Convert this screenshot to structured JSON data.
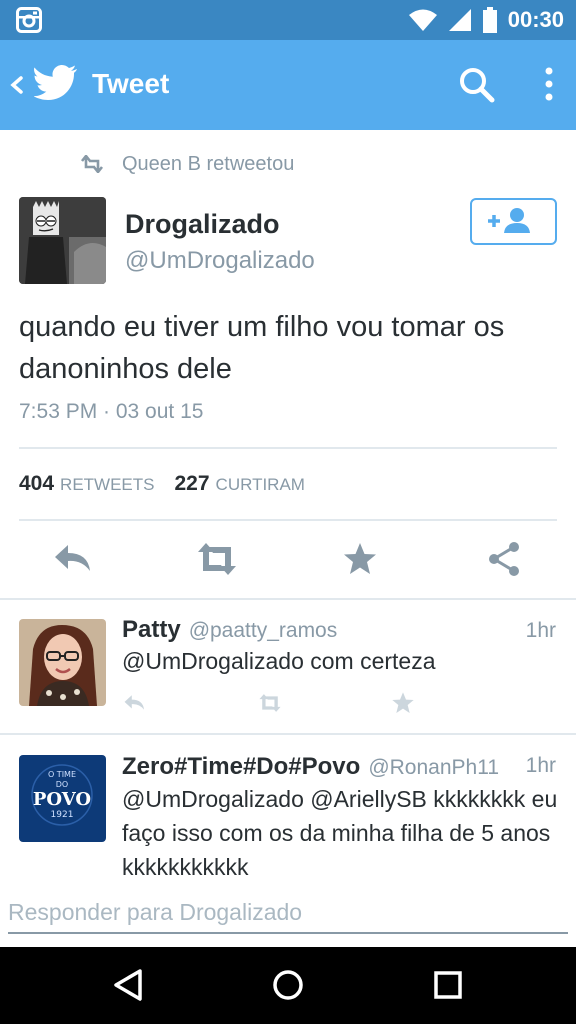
{
  "status_bar": {
    "time": "00:30"
  },
  "app_bar": {
    "title": "Tweet"
  },
  "retweet_context": "Queen B retweetou",
  "tweet": {
    "author_name": "Drogalizado",
    "author_handle": "@UmDrogalizado",
    "text": "quando eu tiver um filho vou tomar os danoninhos dele",
    "timestamp": "7:53 PM · 03 out 15",
    "retweets_count": "404",
    "retweets_label": "RETWEETS",
    "likes_count": "227",
    "likes_label": "CURTIRAM"
  },
  "replies": [
    {
      "name": "Patty",
      "handle": "@paatty_ramos",
      "time": "1hr",
      "text": "@UmDrogalizado com certeza"
    },
    {
      "name": "Zero#Time#Do#Povo",
      "handle": "@RonanPh11",
      "time": "1hr",
      "text": "@UmDrogalizado @AriellySB kkkkkkkk eu faço isso com os da minha filha de 5 anos kkkkkkkkkkk",
      "avatar_text": [
        "O TIME",
        "DO",
        "POVO",
        "1921"
      ]
    }
  ],
  "compose": {
    "placeholder": "Responder para Drogalizado"
  },
  "colors": {
    "status_bar": "#3a87c2",
    "app_bar": "#55acee",
    "muted": "#8899a6",
    "text": "#292f33"
  },
  "icons": [
    "instagram-icon",
    "wifi-icon",
    "signal-icon",
    "battery-icon",
    "back-icon",
    "twitter-bird-icon",
    "search-icon",
    "overflow-menu-icon",
    "retweet-icon",
    "follow-icon",
    "reply-icon",
    "star-icon",
    "share-icon",
    "nav-back-icon",
    "nav-home-icon",
    "nav-recents-icon"
  ]
}
